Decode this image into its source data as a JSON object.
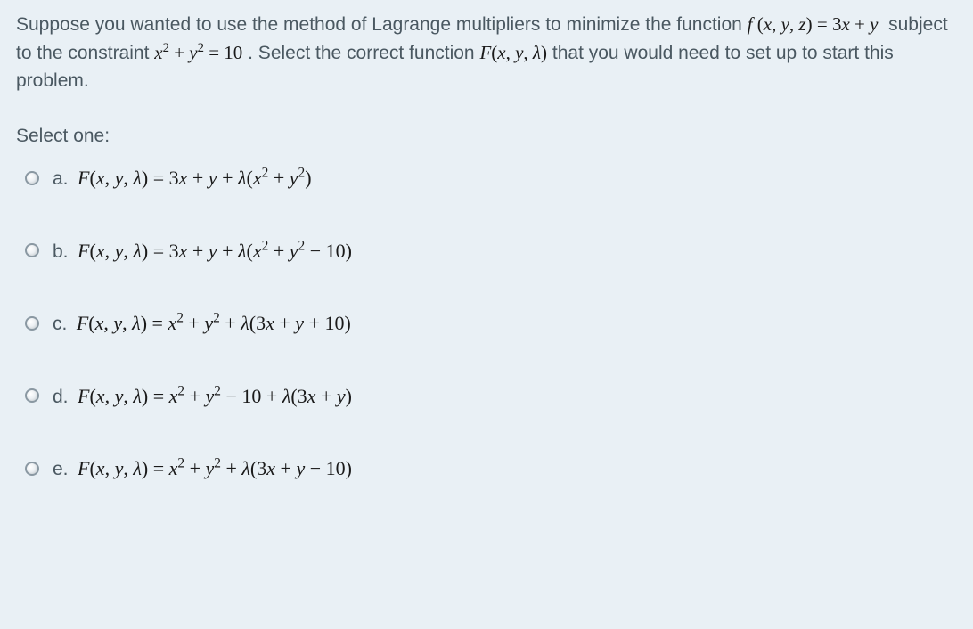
{
  "question": {
    "prefix": "Suppose you wanted to use the method of Lagrange multipliers to minimize the function ",
    "func": "f(x, y, z) = 3x + y",
    "mid1": " subject to the constraint ",
    "constraint": "x² + y² = 10",
    "mid2": ". Select the correct function ",
    "setup": "F(x, y, λ)",
    "suffix": " that you would need to set up to start this problem."
  },
  "select_one": "Select one:",
  "options": [
    {
      "label": "a.",
      "expr": "F(x, y, λ) = 3x + y + λ(x² + y²)"
    },
    {
      "label": "b.",
      "expr": "F(x, y, λ) = 3x + y + λ(x² + y² − 10)"
    },
    {
      "label": "c.",
      "expr": "F(x, y, λ) = x² + y² + λ(3x + y + 10)"
    },
    {
      "label": "d.",
      "expr": "F(x, y, λ) = x² + y² − 10 + λ(3x + y)"
    },
    {
      "label": "e.",
      "expr": "F(x, y, λ) = x² + y² + λ(3x + y − 10)"
    }
  ]
}
